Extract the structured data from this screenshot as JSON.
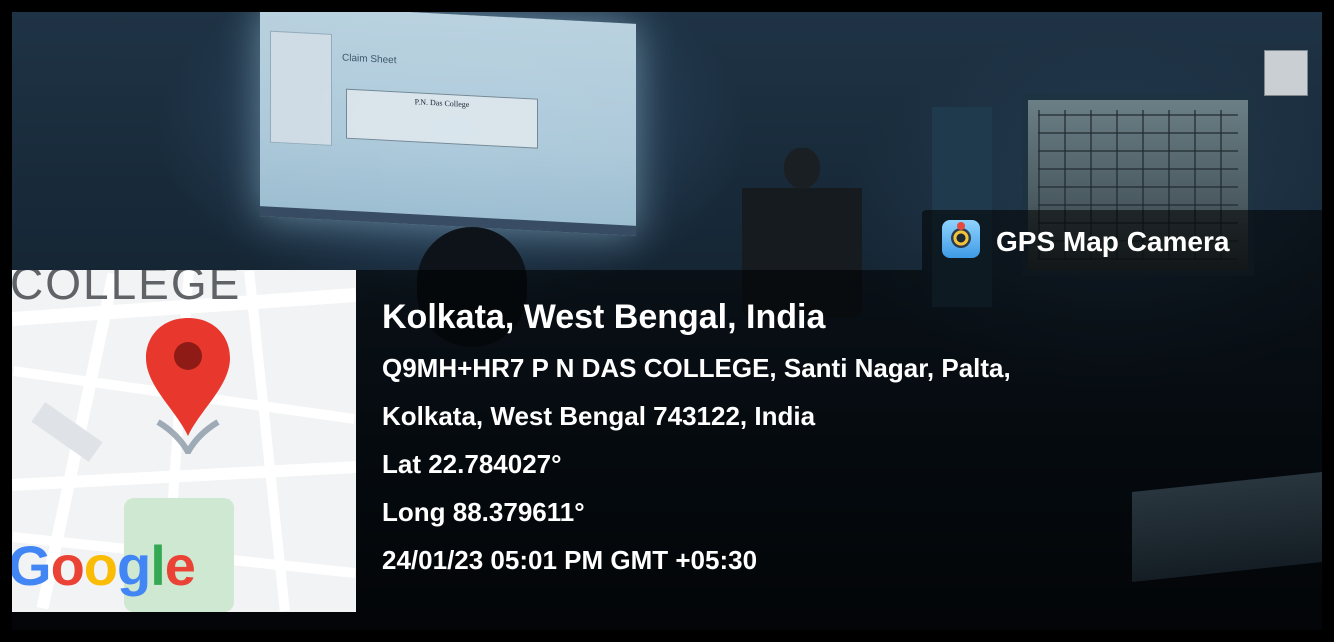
{
  "app_badge": {
    "label": "GPS Map Camera",
    "icon": "gps-map-camera-icon"
  },
  "map": {
    "area_label": "COLLEGE",
    "provider_logo": "Google",
    "logo_colors": [
      "#4285F4",
      "#EA4335",
      "#FBBC05",
      "#4285F4",
      "#34A853",
      "#EA4335"
    ],
    "pin_color": "#EA4335",
    "pin_icon": "map-pin-icon"
  },
  "location": {
    "place": "Kolkata, West Bengal, India",
    "address_line_1": "Q9MH+HR7 P N DAS COLLEGE, Santi Nagar, Palta,",
    "address_line_2": "Kolkata, West Bengal 743122, India",
    "latitude": "Lat 22.784027°",
    "longitude": "Long 88.379611°",
    "timestamp": "24/01/23 05:01 PM GMT +05:30"
  },
  "projection": {
    "title": "Claim Sheet",
    "college_name": "P.N. Das College"
  }
}
